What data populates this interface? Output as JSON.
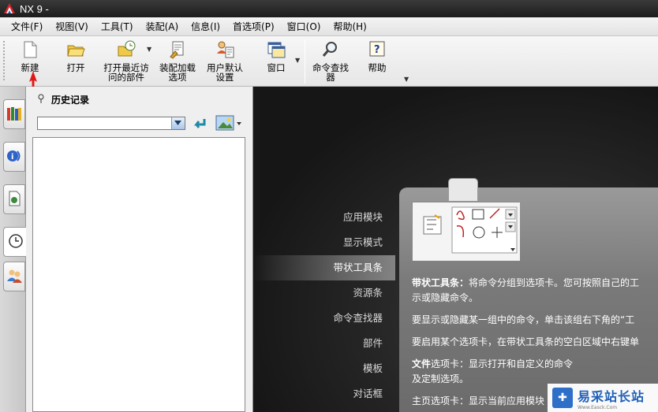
{
  "window": {
    "title": "NX 9 -"
  },
  "menu": [
    {
      "label": "文件(F)"
    },
    {
      "label": "视图(V)"
    },
    {
      "label": "工具(T)"
    },
    {
      "label": "装配(A)"
    },
    {
      "label": "信息(I)"
    },
    {
      "label": "首选项(P)"
    },
    {
      "label": "窗口(O)"
    },
    {
      "label": "帮助(H)"
    }
  ],
  "toolbar": {
    "new": "新建",
    "open": "打开",
    "recent": "打开最近访\n问的部件",
    "assembly_load": "装配加载\n选项",
    "user_defaults": "用户默认\n设置",
    "window": "窗口",
    "command_finder": "命令查找\n器",
    "help": "帮助"
  },
  "history": {
    "title": "历史记录",
    "combo_value": ""
  },
  "roles": [
    {
      "label": "应用模块"
    },
    {
      "label": "显示模式"
    },
    {
      "label": "带状工具条"
    },
    {
      "label": "资源条"
    },
    {
      "label": "命令查找器"
    },
    {
      "label": "部件"
    },
    {
      "label": "模板"
    },
    {
      "label": "对话框"
    }
  ],
  "card": {
    "p1_bold": "带状工具条：",
    "p1": "将命令分组到选项卡。您可按照自己的工",
    "p1b": "示或隐藏命令。",
    "p2": "要显示或隐藏某一组中的命令，单击该组右下角的“工",
    "p3": "要启用某个选项卡，在带状工具条的空白区域中右键单",
    "p4_bold": "文件",
    "p4": "选项卡：显示打开和自定义的命令",
    "p4b": "及定制选项。",
    "p5": "主页选项卡：显示当前应用模块"
  },
  "watermark": {
    "title": "易采站长站",
    "url": "Www.Easck.Com"
  },
  "colors": {
    "accent_arrow": "#e01818",
    "title_bg": "#1c1c1c",
    "main_bg": "#161616"
  }
}
